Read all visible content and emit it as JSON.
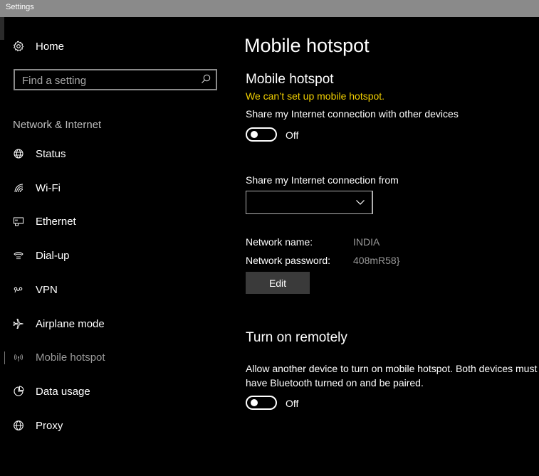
{
  "window": {
    "title": "Settings"
  },
  "sidebar": {
    "home_label": "Home",
    "search_placeholder": "Find a setting",
    "section_label": "Network & Internet",
    "items": [
      {
        "label": "Status",
        "icon": "globe-status-icon"
      },
      {
        "label": "Wi-Fi",
        "icon": "wifi-icon"
      },
      {
        "label": "Ethernet",
        "icon": "ethernet-icon"
      },
      {
        "label": "Dial-up",
        "icon": "dialup-icon"
      },
      {
        "label": "VPN",
        "icon": "vpn-icon"
      },
      {
        "label": "Airplane mode",
        "icon": "airplane-icon"
      },
      {
        "label": "Mobile hotspot",
        "icon": "hotspot-icon",
        "active": true
      },
      {
        "label": "Data usage",
        "icon": "data-usage-icon"
      },
      {
        "label": "Proxy",
        "icon": "globe-icon"
      }
    ]
  },
  "main": {
    "page_title": "Mobile hotspot",
    "section_title": "Mobile hotspot",
    "warning": "We can’t set up mobile hotspot.",
    "share_label": "Share my Internet connection with other devices",
    "share_toggle": {
      "state": "Off"
    },
    "share_from_label": "Share my Internet connection from",
    "share_from_value": "",
    "network_name_label": "Network name:",
    "network_name_value": "INDIA",
    "network_password_label": "Network password:",
    "network_password_value": "408mR58}",
    "edit_label": "Edit",
    "remote_title": "Turn on remotely",
    "remote_desc": "Allow another device to turn on mobile hotspot. Both devices must have Bluetooth turned on and be paired.",
    "remote_toggle": {
      "state": "Off"
    }
  },
  "colors": {
    "background": "#000000",
    "titlebar": "#8a8a8a",
    "warning": "#f2d000",
    "muted_text": "#9a9a9a",
    "button": "#3a3a3a"
  }
}
